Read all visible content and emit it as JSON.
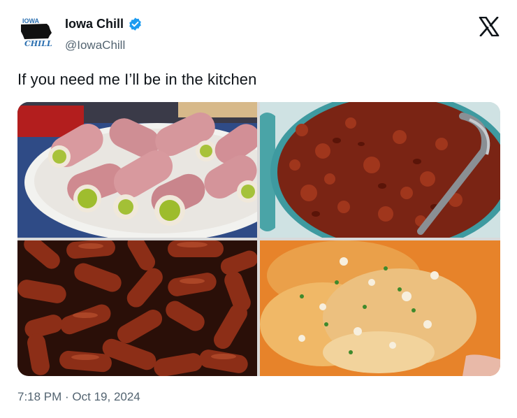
{
  "post": {
    "avatar_text_top": "IOWA",
    "avatar_text_bottom": "CHILL",
    "display_name": "Iowa Chill",
    "handle": "@IowaChill",
    "text": "If you need me I’ll be in the kitchen",
    "timestamp": "7:18 PM · Oct 19, 2024"
  },
  "media": {
    "photos": [
      {
        "subject": "ham-pickle-roll-ups"
      },
      {
        "subject": "chili-pot"
      },
      {
        "subject": "little-smokies-sausages"
      },
      {
        "subject": "buffalo-chicken-dip"
      }
    ]
  },
  "icons": {
    "verified": "verified-badge-icon",
    "platform": "x-logo-icon"
  },
  "colors": {
    "verified_blue": "#1d9bf0",
    "text_primary": "#0f1419",
    "text_secondary": "#536471"
  }
}
